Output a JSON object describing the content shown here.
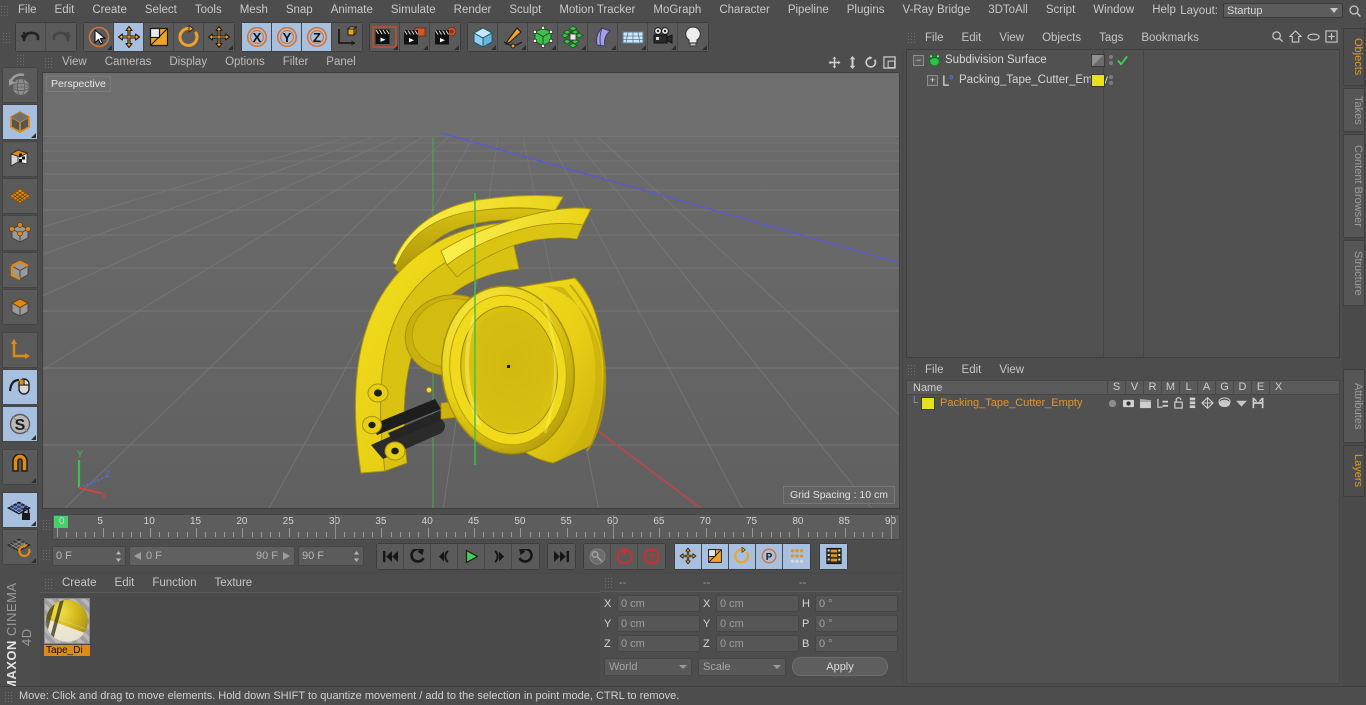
{
  "app": {
    "brand_top": "MAXON",
    "brand_bottom": "CINEMA 4D"
  },
  "menubar": {
    "items": [
      "File",
      "Edit",
      "Create",
      "Select",
      "Tools",
      "Mesh",
      "Snap",
      "Animate",
      "Simulate",
      "Render",
      "Sculpt",
      "Motion Tracker",
      "MoGraph",
      "Character",
      "Pipeline",
      "Plugins",
      "V-Ray Bridge",
      "3DToAll",
      "Script",
      "Window",
      "Help"
    ],
    "layout_label": "Layout:",
    "layout_value": "Startup"
  },
  "toolbar": {
    "groups": [
      {
        "name": "undo-redo",
        "buttons": [
          {
            "name": "undo-button",
            "icon": "undo-icon",
            "selected": false
          },
          {
            "name": "redo-button",
            "icon": "redo-icon",
            "selected": false
          }
        ]
      },
      {
        "name": "transform-tools",
        "buttons": [
          {
            "name": "live-selection-tool",
            "icon": "cursor-circle-icon",
            "selected": false
          },
          {
            "name": "move-tool",
            "icon": "move-arrows-icon",
            "selected": true
          },
          {
            "name": "scale-tool",
            "icon": "scale-box-icon",
            "selected": false
          },
          {
            "name": "rotate-tool",
            "icon": "rotate-circle-icon",
            "selected": false
          },
          {
            "name": "dynamic-place-tool",
            "icon": "move-arrows-icon",
            "selected": false
          }
        ]
      },
      {
        "name": "axis-locks",
        "buttons": [
          {
            "name": "x-axis-lock",
            "icon": "x-axis-icon",
            "selected": true
          },
          {
            "name": "y-axis-lock",
            "icon": "y-axis-icon",
            "selected": true
          },
          {
            "name": "z-axis-lock",
            "icon": "z-axis-icon",
            "selected": true
          },
          {
            "name": "world-object-coord-toggle",
            "icon": "world-coord-icon",
            "selected": false
          }
        ]
      },
      {
        "name": "render-tools",
        "buttons": [
          {
            "name": "render-view-button",
            "icon": "render-view-icon",
            "selected": false
          },
          {
            "name": "render-region-button",
            "icon": "render-region-icon",
            "selected": false
          },
          {
            "name": "render-settings-button",
            "icon": "render-settings-icon",
            "selected": false
          }
        ]
      },
      {
        "name": "create-tools",
        "buttons": [
          {
            "name": "add-cube-button",
            "icon": "cube-blue-icon",
            "selected": false
          },
          {
            "name": "add-spline-button",
            "icon": "pen-spline-icon",
            "selected": false
          },
          {
            "name": "add-generator-button",
            "icon": "green-cube-nurbs-icon",
            "selected": false
          },
          {
            "name": "add-array-button",
            "icon": "green-cluster-icon",
            "selected": false
          },
          {
            "name": "add-deformer-button",
            "icon": "bend-deformer-icon",
            "selected": false
          },
          {
            "name": "add-environment-button",
            "icon": "floor-grid-icon",
            "selected": false
          },
          {
            "name": "add-camera-button",
            "icon": "camera-icon",
            "selected": false
          },
          {
            "name": "add-light-button",
            "icon": "light-bulb-icon",
            "selected": false
          }
        ]
      }
    ]
  },
  "left_toolbar": {
    "items": [
      {
        "name": "undo-view-button",
        "icon": "globe-arrow-icon",
        "selected": false
      },
      {
        "name": "model-mode-button",
        "icon": "model-cube-icon",
        "selected": true
      },
      {
        "name": "texture-mode-button",
        "icon": "texture-cube-icon",
        "selected": false
      },
      {
        "name": "workplane-button",
        "icon": "grid-plane-icon",
        "selected": false
      },
      {
        "name": "point-mode-button",
        "icon": "points-cube-icon",
        "selected": false
      },
      {
        "name": "edge-mode-button",
        "icon": "edges-cube-icon",
        "selected": false
      },
      {
        "name": "polygon-mode-button",
        "icon": "polygon-cube-icon",
        "selected": false
      },
      {
        "name": "object-axis-button",
        "icon": "axis-icon",
        "selected": false
      },
      {
        "name": "enable-axis-button",
        "icon": "mouse-axis-icon",
        "selected": true
      },
      {
        "name": "soft-selection-button",
        "icon": "s-circle-icon",
        "selected": true
      },
      {
        "name": "snap-toggle-button",
        "icon": "magnet-icon",
        "selected": false
      },
      {
        "name": "workplane-lock-button",
        "icon": "plane-lock-icon",
        "selected": true
      },
      {
        "name": "planar-rotate-button",
        "icon": "plane-rotate-icon",
        "selected": false
      }
    ]
  },
  "viewport": {
    "menu": [
      "View",
      "Cameras",
      "Display",
      "Options",
      "Filter",
      "Panel"
    ],
    "label": "Perspective",
    "grid_spacing": "Grid Spacing : 10 cm",
    "axis_gizmo": {
      "y": "Y",
      "z": "Z",
      "x": "X"
    },
    "right_icons": [
      "pan-icon",
      "dolly-icon",
      "rotate-view-icon",
      "maximize-view-icon"
    ],
    "model_description": "yellow packing tape cutter dispenser"
  },
  "timeline": {
    "ticks": [
      0,
      5,
      10,
      15,
      20,
      25,
      30,
      35,
      40,
      45,
      50,
      55,
      60,
      65,
      70,
      75,
      80,
      85,
      90
    ],
    "current_frame_field": "0 F",
    "range_start": "0 F",
    "range_end": "90 F",
    "end_frame_field": "90 F",
    "right_frame_field": "0 F",
    "transport": [
      {
        "name": "go-to-start-button",
        "icon": "skip-start-icon"
      },
      {
        "name": "play-backwards-button",
        "icon": "rewind-icon"
      },
      {
        "name": "previous-frame-button",
        "icon": "step-back-icon"
      },
      {
        "name": "play-button",
        "icon": "play-icon"
      },
      {
        "name": "next-frame-button",
        "icon": "step-forward-icon"
      },
      {
        "name": "play-forward-button",
        "icon": "forward-icon"
      },
      {
        "name": "go-to-end-button",
        "icon": "skip-end-icon"
      }
    ],
    "keyframe_tools": [
      {
        "name": "autokey-button",
        "icon": "key-icon",
        "selected": false
      },
      {
        "name": "record-keyframe-button",
        "icon": "record-red-icon",
        "selected": false
      },
      {
        "name": "keyframe-selection-button",
        "icon": "question-red-icon",
        "selected": false
      }
    ],
    "record_flags": [
      {
        "name": "record-position-button",
        "icon": "move-arrows-icon",
        "selected": true
      },
      {
        "name": "record-scale-button",
        "icon": "scale-box-icon",
        "selected": true
      },
      {
        "name": "record-rotation-button",
        "icon": "rotate-circle-icon",
        "selected": true
      },
      {
        "name": "record-parameter-button",
        "icon": "p-circle-icon",
        "selected": true
      },
      {
        "name": "record-pla-button",
        "icon": "point-level-anim-icon",
        "selected": true
      }
    ],
    "timeline_toggle": {
      "name": "timeline-view-button",
      "icon": "timeline-film-icon",
      "selected": true
    }
  },
  "material_manager": {
    "menu": [
      "Create",
      "Edit",
      "Function",
      "Texture"
    ],
    "materials": [
      {
        "name": "Tape_Di"
      }
    ]
  },
  "coordinates": {
    "headers": [
      "--",
      "--",
      "--"
    ],
    "rows": [
      {
        "pos_label": "X",
        "pos_value": "0 cm",
        "size_label": "X",
        "size_value": "0 cm",
        "rot_label": "H",
        "rot_value": "0 °"
      },
      {
        "pos_label": "Y",
        "pos_value": "0 cm",
        "size_label": "Y",
        "size_value": "0 cm",
        "rot_label": "P",
        "rot_value": "0 °"
      },
      {
        "pos_label": "Z",
        "pos_value": "0 cm",
        "size_label": "Z",
        "size_value": "0 cm",
        "rot_label": "B",
        "rot_value": "0 °"
      }
    ],
    "coord_system": "World",
    "mode": "Scale",
    "apply_label": "Apply"
  },
  "object_manager": {
    "menu": [
      "File",
      "Edit",
      "View",
      "Objects",
      "Tags",
      "Bookmarks"
    ],
    "icons": [
      "search-icon",
      "home-icon",
      "eye-icon",
      "expand-icon"
    ],
    "objects": [
      {
        "name": "Subdivision Surface",
        "icon": "subdivision-surface-icon",
        "depth": 0,
        "swatch_color": "#8a8a8a",
        "swatch_type": "gradient",
        "check": true
      },
      {
        "name": "Packing_Tape_Cutter_Empty",
        "icon": "null-object-icon",
        "depth": 1,
        "swatch_color": "#e8e21a",
        "swatch_type": "solid",
        "check": false
      }
    ]
  },
  "layer_manager": {
    "menu": [
      "File",
      "Edit",
      "View"
    ],
    "columns": [
      "Name",
      "S",
      "V",
      "R",
      "M",
      "L",
      "A",
      "G",
      "D",
      "E",
      "X"
    ],
    "rows": [
      {
        "name": "Packing_Tape_Cutter_Empty",
        "color": "#e8e21a"
      }
    ]
  },
  "right_tabs": {
    "top": [
      {
        "label": "Objects",
        "active": true
      },
      {
        "label": "Takes",
        "active": false
      },
      {
        "label": "Content Browser",
        "active": false
      },
      {
        "label": "Structure",
        "active": false
      }
    ],
    "bottom": [
      {
        "label": "Attributes",
        "active": false
      },
      {
        "label": "Layers",
        "active": true
      }
    ]
  },
  "statusbar": {
    "message": "Move: Click and drag to move elements. Hold down SHIFT to quantize movement / add to the selection in point mode, CTRL to remove."
  },
  "colors": {
    "panel_bg": "#4d4d4d",
    "field_bg": "#5a5a5a",
    "selected_blue": "#a7c0e0",
    "orange_accent": "#e09a23",
    "model_yellow": "#e8d21a",
    "viewport_bg": "#666666"
  }
}
